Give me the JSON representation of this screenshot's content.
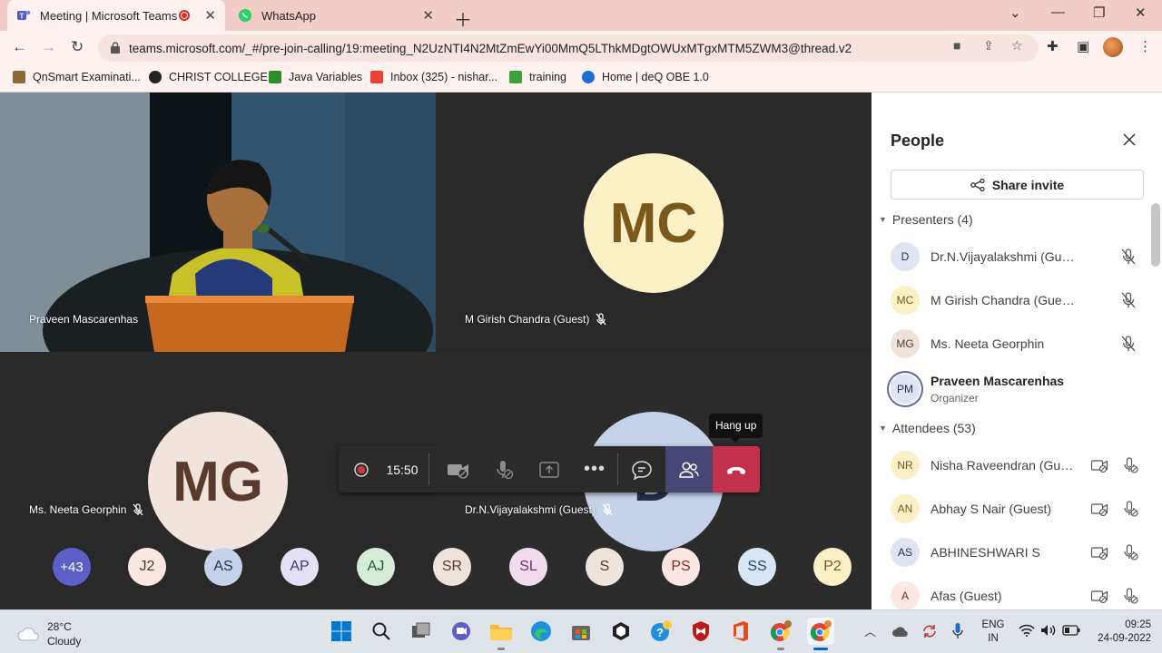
{
  "browser": {
    "tabs": [
      {
        "title": "Meeting | Microsoft Teams",
        "close": "✕"
      },
      {
        "title": "WhatsApp",
        "close": "✕"
      }
    ],
    "url": "teams.microsoft.com/_#/pre-join-calling/19:meeting_N2UzNTI4N2MtZmEwYi00MmQ5LThkMDgtOWUxMTgxMTM5ZWM3@thread.v2",
    "bookmarks": [
      "QnSmart Examinati...",
      "CHRIST COLLEGE",
      "Java Variables",
      "Inbox (325) - nishar...",
      "training",
      "Home | deQ OBE 1.0"
    ]
  },
  "stage": {
    "tiles": [
      {
        "name": "Praveen Mascarenhas"
      },
      {
        "name": "M Girish Chandra (Guest)",
        "initials": "MC"
      },
      {
        "name": "Ms. Neeta Georphin",
        "initials": "MG"
      },
      {
        "name": "Dr.N.Vijayalakshmi (Guest)",
        "initials": "D"
      }
    ],
    "timer": "15:50",
    "tooltip": "Hang up",
    "strip": [
      "+43",
      "J2",
      "AS",
      "AP",
      "AJ",
      "SR",
      "SL",
      "S",
      "PS",
      "SS",
      "P2"
    ]
  },
  "people_panel": {
    "title": "People",
    "share_invite": "Share invite",
    "presenters_header": "Presenters (4)",
    "presenters": [
      {
        "initials": "D",
        "name": "Dr.N.Vijayalakshmi (Guest)"
      },
      {
        "initials": "MC",
        "name": "M Girish Chandra (Guest)"
      },
      {
        "initials": "MG",
        "name": "Ms. Neeta Georphin"
      },
      {
        "initials": "PM",
        "name": "Praveen Mascarenhas",
        "role": "Organizer"
      }
    ],
    "attendees_header": "Attendees (53)",
    "attendees": [
      {
        "initials": "NR",
        "name": "Nisha Raveendran (Gue..."
      },
      {
        "initials": "AN",
        "name": "Abhay S Nair (Guest)"
      },
      {
        "initials": "AS",
        "name": "ABHINESHWARI S"
      },
      {
        "initials": "A",
        "name": "Afas (Guest)"
      }
    ]
  },
  "taskbar": {
    "weather_temp": "28°C",
    "weather_desc": "Cloudy",
    "lang_top": "ENG",
    "lang_bottom": "IN",
    "time": "09:25",
    "date": "24-09-2022"
  },
  "colors": {
    "teams_purple": "#464775",
    "hangup_red": "#c4314b",
    "chrome_tab_bg": "#f1cdc6"
  }
}
